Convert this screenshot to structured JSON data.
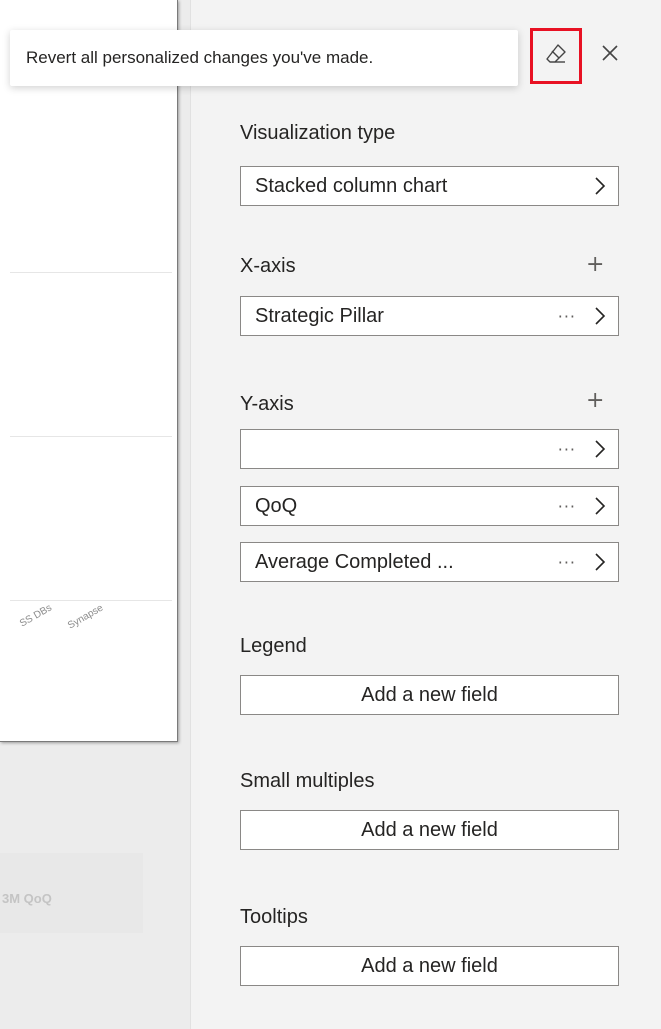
{
  "tooltip": {
    "text": "Revert all personalized changes you've made."
  },
  "chart_bg": {
    "labels": [
      "SS DBs",
      "Synapse"
    ],
    "card2_label": "3M QoQ"
  },
  "pane": {
    "visualization_type": {
      "label": "Visualization type",
      "value": "Stacked column chart"
    },
    "x_axis": {
      "label": "X-axis",
      "add": "+",
      "fields": [
        {
          "value": "Strategic Pillar",
          "more": "···"
        }
      ]
    },
    "y_axis": {
      "label": "Y-axis",
      "add": "+",
      "fields": [
        {
          "value": "",
          "more": "···"
        },
        {
          "value": "QoQ",
          "more": "···"
        },
        {
          "value": "Average Completed ...",
          "more": "···"
        }
      ]
    },
    "legend": {
      "label": "Legend",
      "placeholder": "Add a new field"
    },
    "small_multiples": {
      "label": "Small multiples",
      "placeholder": "Add a new field"
    },
    "tooltips": {
      "label": "Tooltips",
      "placeholder": "Add a new field"
    }
  },
  "icons": {
    "revert": "eraser-icon",
    "close": "close-icon",
    "chevron": "chevron-right-icon"
  },
  "colors": {
    "highlight": "#e81123"
  }
}
